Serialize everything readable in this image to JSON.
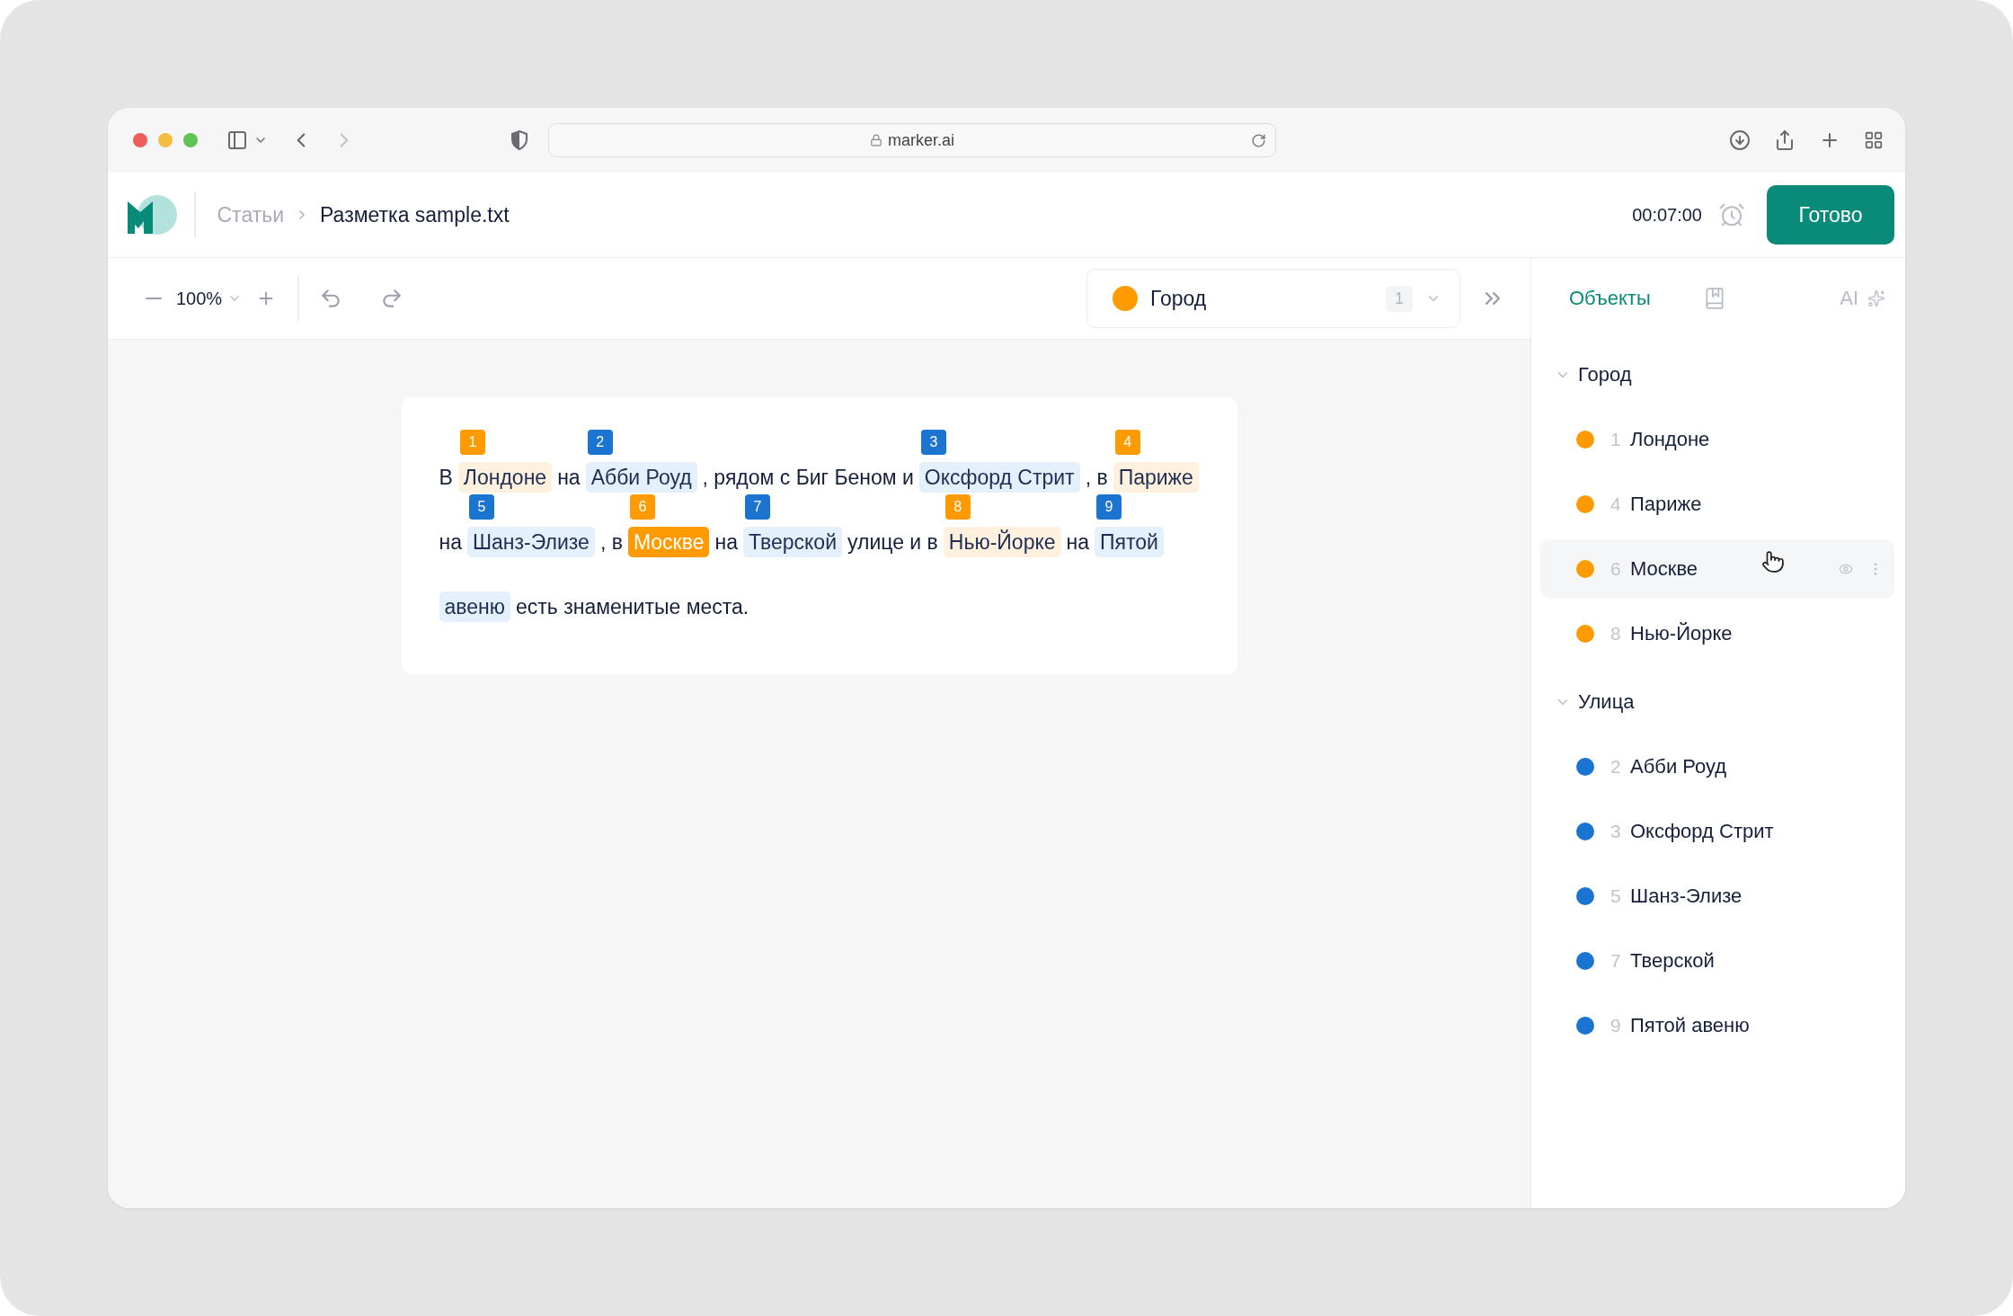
{
  "browser": {
    "url": "marker.ai"
  },
  "header": {
    "breadcrumbs": [
      {
        "label": "Статьи",
        "current": false
      },
      {
        "label": "Разметка sample.txt",
        "current": true
      }
    ],
    "timer": "00:07:00",
    "done_button": "Готово"
  },
  "toolbar": {
    "zoom": "100%",
    "type_selector": {
      "label": "Город",
      "color": "#ff9a00",
      "count": "1"
    }
  },
  "document": {
    "lines": [
      [
        {
          "kind": "text",
          "text": "В"
        },
        {
          "kind": "entity",
          "text": "Лондоне",
          "badge": {
            "number": "1",
            "color": "#ff9a00"
          },
          "color": "#fff1de",
          "selected": false
        },
        {
          "kind": "text",
          "text": "на"
        },
        {
          "kind": "entity",
          "text": "Абби Роуд",
          "badge": {
            "number": "2",
            "color": "#1b75d0"
          },
          "color": "#e4f0fc",
          "selected": false
        },
        {
          "kind": "text",
          "text": ", рядом с Биг Беном и"
        },
        {
          "kind": "entity",
          "text": "Оксфорд Стрит",
          "badge": {
            "number": "3",
            "color": "#1b75d0"
          },
          "color": "#e4f0fc",
          "selected": false
        },
        {
          "kind": "text",
          "text": ", в"
        },
        {
          "kind": "entity",
          "text": "Париже",
          "badge": {
            "number": "4",
            "color": "#ff9a00"
          },
          "color": "#fff1de",
          "selected": false
        }
      ],
      [
        {
          "kind": "text",
          "text": "на"
        },
        {
          "kind": "entity",
          "text": "Шанз-Элизе",
          "badge": {
            "number": "5",
            "color": "#1b75d0"
          },
          "color": "#e4f0fc",
          "selected": false
        },
        {
          "kind": "text",
          "text": ", в"
        },
        {
          "kind": "entity",
          "text": "Москве",
          "badge": {
            "number": "6",
            "color": "#ff9a00"
          },
          "color": "#ff9a00",
          "selected": true
        },
        {
          "kind": "text",
          "text": "на"
        },
        {
          "kind": "entity",
          "text": "Тверской",
          "badge": {
            "number": "7",
            "color": "#1b75d0"
          },
          "color": "#e4f0fc",
          "selected": false
        },
        {
          "kind": "text",
          "text": "улице и в"
        },
        {
          "kind": "entity",
          "text": "Нью-Йорке",
          "badge": {
            "number": "8",
            "color": "#ff9a00"
          },
          "color": "#fff1de",
          "selected": false
        },
        {
          "kind": "text",
          "text": "на"
        },
        {
          "kind": "entity",
          "text": "Пятой",
          "badge": {
            "number": "9",
            "color": "#1b75d0"
          },
          "color": "#e4f0fc",
          "selected": false
        }
      ],
      [
        {
          "kind": "entity",
          "text": "авеню",
          "color": "#e4f0fc",
          "selected": false
        },
        {
          "kind": "text",
          "text": "есть знаменитые места."
        }
      ]
    ]
  },
  "panel": {
    "tabs": [
      {
        "kind": "objects",
        "label": "Объекты",
        "selected": true
      },
      {
        "kind": "book",
        "selected": false
      },
      {
        "kind": "ai",
        "label": "AI",
        "selected": false
      }
    ],
    "groups": [
      {
        "name": "Город",
        "expanded": true,
        "items": [
          {
            "number": "1",
            "name": "Лондоне",
            "color": "#ff9a00",
            "hovered": false
          },
          {
            "number": "4",
            "name": "Париже",
            "color": "#ff9a00",
            "hovered": false
          },
          {
            "number": "6",
            "name": "Москве",
            "color": "#ff9a00",
            "hovered": true
          },
          {
            "number": "8",
            "name": "Нью-Йорке",
            "color": "#ff9a00",
            "hovered": false
          }
        ]
      },
      {
        "name": "Улица",
        "expanded": true,
        "items": [
          {
            "number": "2",
            "name": "Абби Роуд",
            "color": "#1b75d0",
            "hovered": false
          },
          {
            "number": "3",
            "name": "Оксфорд Стрит",
            "color": "#1b75d0",
            "hovered": false
          },
          {
            "number": "5",
            "name": "Шанз-Элизе",
            "color": "#1b75d0",
            "hovered": false
          },
          {
            "number": "7",
            "name": "Тверской",
            "color": "#1b75d0",
            "hovered": false
          },
          {
            "number": "9",
            "name": "Пятой авеню",
            "color": "#1b75d0",
            "hovered": false
          }
        ]
      }
    ]
  }
}
